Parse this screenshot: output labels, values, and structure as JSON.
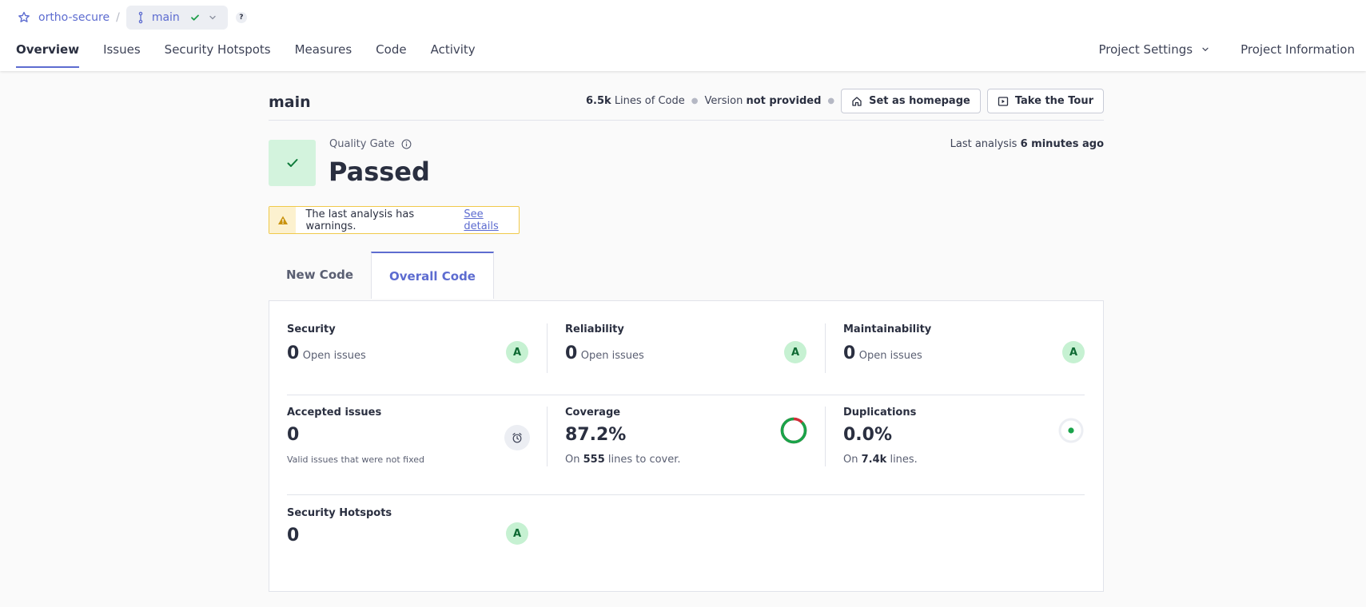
{
  "breadcrumb": {
    "project": "ortho-secure",
    "separator": "/",
    "branch": "main",
    "help": "?"
  },
  "nav": {
    "tabs": [
      "Overview",
      "Issues",
      "Security Hotspots",
      "Measures",
      "Code",
      "Activity"
    ],
    "right": {
      "settings": "Project Settings",
      "info": "Project Information"
    }
  },
  "header": {
    "title": "main",
    "loc_value": "6.5k",
    "loc_label": "Lines of Code",
    "version_label": "Version",
    "version_value": "not provided",
    "homepage_btn": "Set as homepage",
    "tour_btn": "Take the Tour"
  },
  "quality_gate": {
    "label": "Quality Gate",
    "status": "Passed",
    "last_analysis_label": "Last analysis",
    "last_analysis_value": "6 minutes ago"
  },
  "warning": {
    "text": "The last analysis has warnings.",
    "link": "See details"
  },
  "code_tabs": [
    "New Code",
    "Overall Code"
  ],
  "metrics": {
    "security": {
      "title": "Security",
      "value": "0",
      "label": "Open issues",
      "grade": "A"
    },
    "reliability": {
      "title": "Reliability",
      "value": "0",
      "label": "Open issues",
      "grade": "A"
    },
    "maintainability": {
      "title": "Maintainability",
      "value": "0",
      "label": "Open issues",
      "grade": "A"
    },
    "accepted": {
      "title": "Accepted issues",
      "value": "0",
      "desc": "Valid issues that were not fixed"
    },
    "coverage": {
      "title": "Coverage",
      "value": "87.2%",
      "pre": "On",
      "lines": "555",
      "post": "lines to cover.",
      "percent": 87.2
    },
    "duplications": {
      "title": "Duplications",
      "value": "0.0%",
      "pre": "On",
      "lines": "7.4k",
      "post": "lines."
    },
    "hotspots": {
      "title": "Security Hotspots",
      "value": "0",
      "grade": "A"
    }
  },
  "colors": {
    "accent": "#5d6cd0",
    "pass_bg": "#d3f3dd",
    "grade_bg": "#c6f1d2",
    "coverage_green": "#1aa34a",
    "coverage_red": "#d02f3a",
    "warning_border": "#f0c94a"
  },
  "icons": [
    "star-icon",
    "branch-icon",
    "check-icon",
    "chevron-down-icon",
    "help-icon",
    "home-icon",
    "play-icon",
    "info-icon",
    "warning-icon",
    "alarm-clock-icon"
  ]
}
